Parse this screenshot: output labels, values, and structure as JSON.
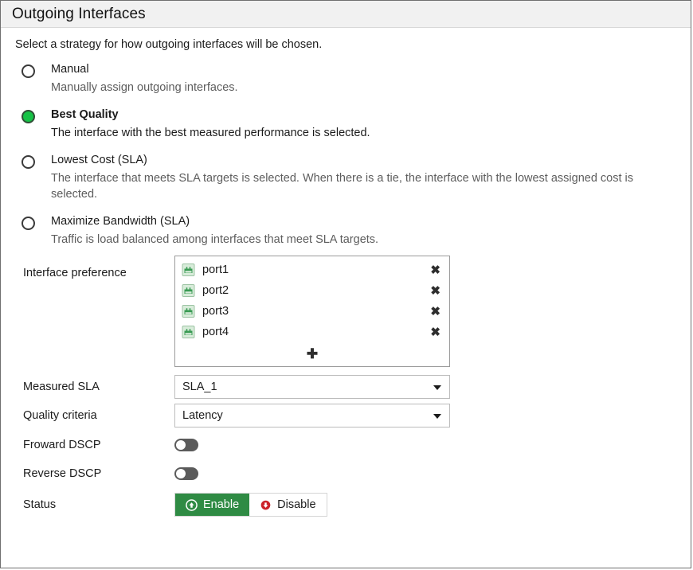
{
  "panel": {
    "title": "Outgoing Interfaces",
    "intro": "Select a strategy for how outgoing interfaces will be chosen."
  },
  "strategies": [
    {
      "label": "Manual",
      "description": "Manually assign outgoing interfaces.",
      "selected": false
    },
    {
      "label": "Best Quality",
      "description": "The interface with the best measured performance is selected.",
      "selected": true
    },
    {
      "label": "Lowest Cost (SLA)",
      "description": "The interface that meets SLA targets is selected. When there is a tie, the interface with the lowest assigned cost is selected.",
      "selected": false
    },
    {
      "label": "Maximize Bandwidth (SLA)",
      "description": "Traffic is load balanced among interfaces that meet SLA targets.",
      "selected": false
    }
  ],
  "form": {
    "interface_preference": {
      "label": "Interface preference",
      "items": [
        {
          "name": "port1",
          "icon": "network-port-icon",
          "remove_label": "✖"
        },
        {
          "name": "port2",
          "icon": "network-port-icon",
          "remove_label": "✖"
        },
        {
          "name": "port3",
          "icon": "network-port-icon",
          "remove_label": "✖"
        },
        {
          "name": "port4",
          "icon": "network-port-icon",
          "remove_label": "✖"
        }
      ],
      "add_label": "✚"
    },
    "measured_sla": {
      "label": "Measured SLA",
      "value": "SLA_1"
    },
    "quality_criteria": {
      "label": "Quality criteria",
      "value": "Latency"
    },
    "forward_dscp": {
      "label": "Froward DSCP",
      "state": "off"
    },
    "reverse_dscp": {
      "label": "Reverse DSCP",
      "state": "off"
    },
    "status": {
      "label": "Status",
      "enable_label": "Enable",
      "disable_label": "Disable",
      "selected": "Enable"
    }
  },
  "colors": {
    "selected_radio_green": "#16c246",
    "enable_green": "#2f8b44",
    "disable_red": "#cc2229",
    "header_bg": "#f1f1f1",
    "port_icon_green": "#3a9b54"
  }
}
